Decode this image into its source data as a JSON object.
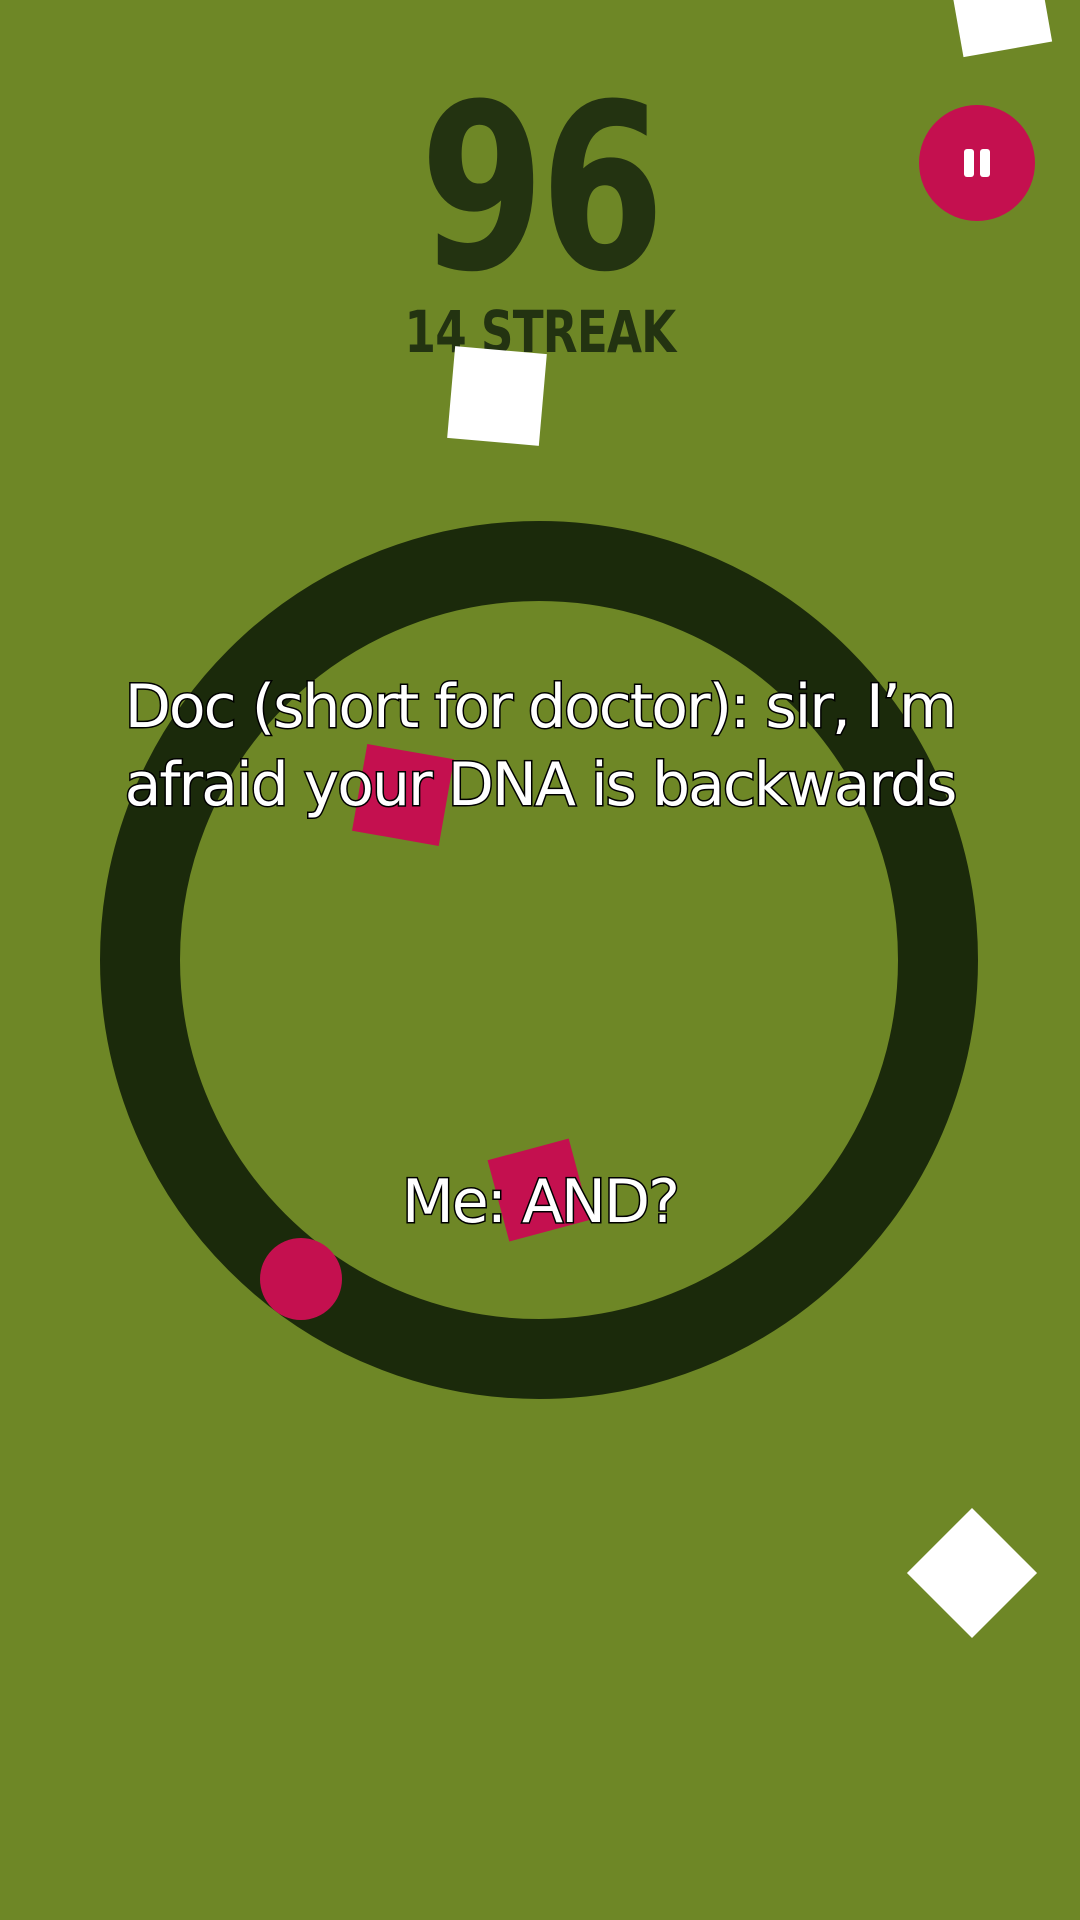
{
  "game": {
    "score": "96",
    "streak": "14 STREAK"
  },
  "controls": {
    "pause_icon": "pause-icon"
  },
  "captions": {
    "top_line1": "Doc (short for doctor): sir, I’m",
    "top_line2": "afraid your DNA is backwards",
    "bottom": "Me: AND?"
  },
  "colors": {
    "background": "#6e8726",
    "ring": "#1b2a0b",
    "score_text": "#233311",
    "accent": "#c4104f",
    "white": "#ffffff"
  }
}
